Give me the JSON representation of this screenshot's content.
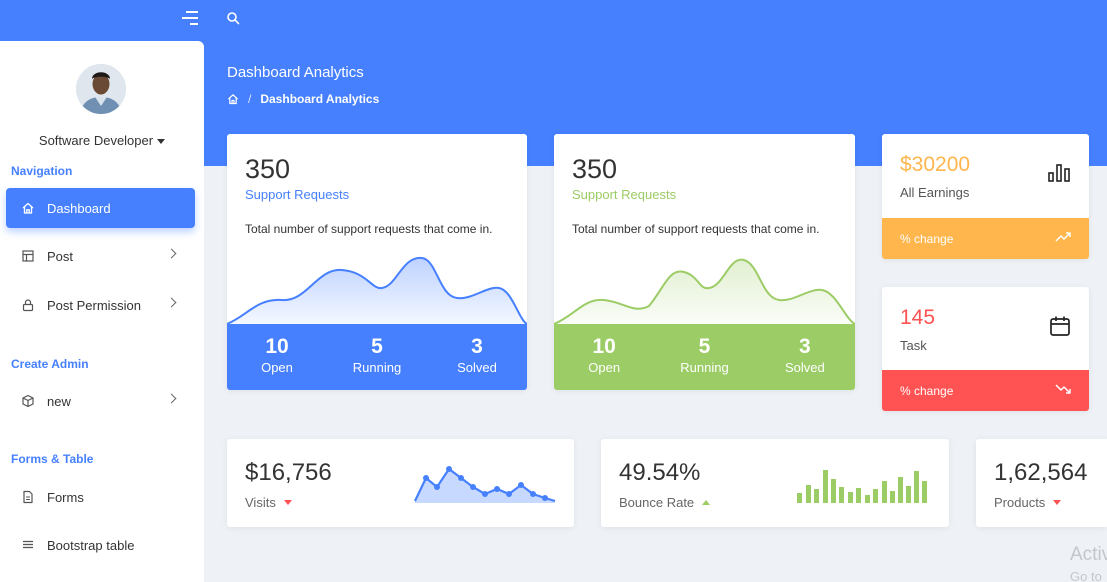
{
  "sidebar": {
    "profile_role": "Software Developer",
    "sections": {
      "navigation": "Navigation",
      "create_admin": "Create Admin",
      "forms_table": "Forms & Table"
    },
    "items": {
      "dashboard": "Dashboard",
      "post": "Post",
      "post_permission": "Post Permission",
      "new": "new",
      "forms": "Forms",
      "bootstrap_table": "Bootstrap table"
    }
  },
  "header": {
    "title": "Dashboard Analytics",
    "breadcrumb": "Dashboard Analytics"
  },
  "support_cards": [
    {
      "count": "350",
      "label": "Support Requests",
      "description": "Total number of support requests that come in.",
      "accent": "#4680ff",
      "stats": [
        {
          "value": "10",
          "label": "Open"
        },
        {
          "value": "5",
          "label": "Running"
        },
        {
          "value": "3",
          "label": "Solved"
        }
      ]
    },
    {
      "count": "350",
      "label": "Support Requests",
      "description": "Total number of support requests that come in.",
      "accent": "#9ccc65",
      "stats": [
        {
          "value": "10",
          "label": "Open"
        },
        {
          "value": "5",
          "label": "Running"
        },
        {
          "value": "3",
          "label": "Solved"
        }
      ]
    }
  ],
  "earnings": {
    "value": "$30200",
    "label": "All Earnings",
    "footer": "% change",
    "color": "#ffb64d"
  },
  "task": {
    "value": "145",
    "label": "Task",
    "footer": "% change",
    "color": "#ff5252"
  },
  "kpis": [
    {
      "value": "$16,756",
      "label": "Visits",
      "trend": "down"
    },
    {
      "value": "49.54%",
      "label": "Bounce Rate",
      "trend": "up"
    },
    {
      "value": "1,62,564",
      "label": "Products",
      "trend": "down"
    }
  ],
  "watermark": {
    "line1": "Activ",
    "line2": "Go to"
  }
}
